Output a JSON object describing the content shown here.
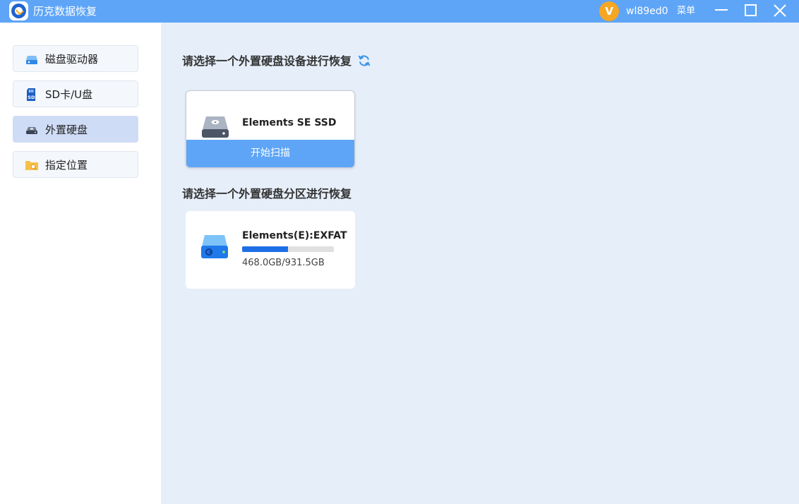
{
  "app": {
    "title": "历克数据恢复"
  },
  "user": {
    "avatar_letter": "V",
    "name": "wl89ed0",
    "menu_label": "菜单"
  },
  "sidebar": {
    "items": [
      {
        "label": "磁盘驱动器",
        "icon": "disk-drive-icon"
      },
      {
        "label": "SD卡/U盘",
        "icon": "sd-card-icon"
      },
      {
        "label": "外置硬盘",
        "icon": "external-drive-icon",
        "active": true
      },
      {
        "label": "指定位置",
        "icon": "folder-search-icon"
      }
    ]
  },
  "main": {
    "device_section_title": "请选择一个外置硬盘设备进行恢复",
    "partition_section_title": "请选择一个外置硬盘分区进行恢复",
    "device": {
      "name": "Elements SE SSD",
      "scan_label": "开始扫描"
    },
    "partition": {
      "name": "Elements(E):EXFAT",
      "size_text": "468.0GB/931.5GB",
      "used_fraction": 0.502
    }
  },
  "colors": {
    "accent": "#5ea5f7",
    "progress": "#1e6fe6",
    "avatar": "#f5a623"
  }
}
